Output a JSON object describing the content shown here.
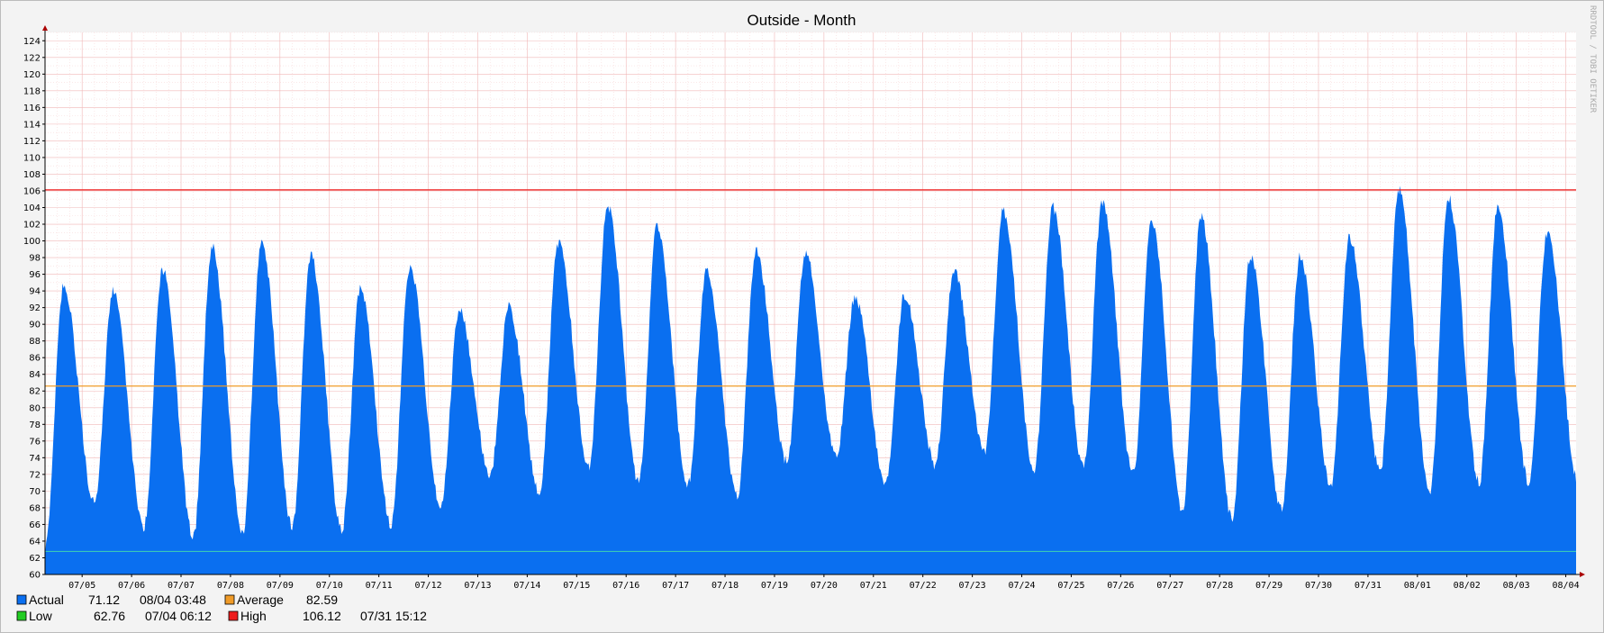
{
  "chart_data": {
    "type": "area",
    "title": "Outside - Month",
    "watermark": "RRDTOOL / TOBI OETIKER",
    "xlabel": "",
    "ylabel": "",
    "ylim": [
      60,
      125
    ],
    "y_ticks": [
      60,
      62,
      64,
      66,
      68,
      70,
      72,
      74,
      76,
      78,
      80,
      82,
      84,
      86,
      88,
      90,
      92,
      94,
      96,
      98,
      100,
      102,
      104,
      106,
      108,
      110,
      112,
      114,
      116,
      118,
      120,
      122,
      124
    ],
    "x_start": "07/04 06:00",
    "x_end": "08/04 05:00",
    "x_tick_labels": [
      "07/05",
      "07/06",
      "07/07",
      "07/08",
      "07/09",
      "07/10",
      "07/11",
      "07/12",
      "07/13",
      "07/14",
      "07/15",
      "07/16",
      "07/17",
      "07/18",
      "07/19",
      "07/20",
      "07/21",
      "07/22",
      "07/23",
      "07/24",
      "07/25",
      "07/26",
      "07/27",
      "07/28",
      "07/29",
      "07/30",
      "07/31",
      "08/01",
      "08/02",
      "08/03",
      "08/04"
    ],
    "grid": true,
    "series": [
      {
        "name": "Actual",
        "color": "#0a6ff0",
        "daily_lows": [
          63.0,
          68.5,
          65.8,
          64.5,
          65.0,
          65.8,
          65.3,
          66.0,
          68.0,
          72.0,
          69.8,
          73.0,
          71.0,
          70.8,
          69.3,
          73.5,
          74.0,
          70.8,
          73.2,
          74.8,
          72.5,
          73.0,
          72.0,
          67.8,
          66.8,
          67.9,
          70.8,
          72.5,
          69.8,
          71.1
        ],
        "daily_highs": [
          94.6,
          94.0,
          96.5,
          99.3,
          100.0,
          98.3,
          94.3,
          97.0,
          91.6,
          92.0,
          99.8,
          104.3,
          101.8,
          96.4,
          98.8,
          98.5,
          93.3,
          93.6,
          96.4,
          103.6,
          104.0,
          104.6,
          102.4,
          103.0,
          98.3,
          98.0,
          100.3,
          106.1,
          105.2,
          104.0,
          101.0
        ],
        "current_label": "Actual",
        "current_value": "71.12",
        "current_time": "08/04 03:48"
      },
      {
        "name": "Average",
        "color": "#f09b28",
        "value_label": "82.59",
        "value": 82.59
      },
      {
        "name": "Low",
        "color": "#22cc22",
        "line_color": "#39c8b8",
        "value_label": "62.76",
        "time": "07/04 06:12",
        "value": 62.76
      },
      {
        "name": "High",
        "color": "#ee1c1c",
        "value_label": "106.12",
        "time": "07/31 15:12",
        "value": 106.12
      }
    ],
    "legend_position": "bottom-left"
  }
}
